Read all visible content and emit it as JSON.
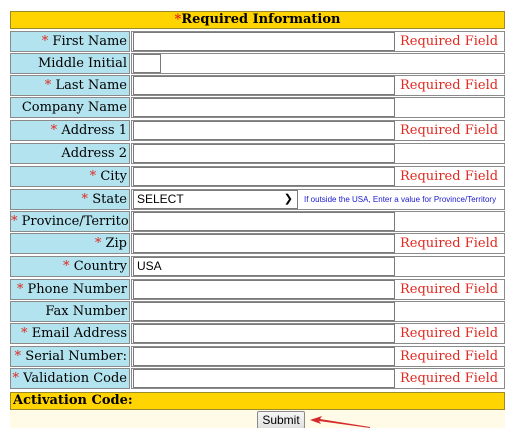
{
  "header": {
    "required_mark": "*",
    "title": "Required Information"
  },
  "fields": [
    {
      "mark": "* ",
      "label": "First Name",
      "value": "",
      "required_text": "Required Field"
    },
    {
      "mark": "",
      "label": "Middle Initial",
      "value": "",
      "required_text": ""
    },
    {
      "mark": "* ",
      "label": "Last Name",
      "value": "",
      "required_text": "Required Field"
    },
    {
      "mark": "",
      "label": "Company Name",
      "value": "",
      "required_text": ""
    },
    {
      "mark": "* ",
      "label": "Address 1",
      "value": "",
      "required_text": "Required Field"
    },
    {
      "mark": "",
      "label": "Address 2",
      "value": "",
      "required_text": ""
    },
    {
      "mark": "* ",
      "label": "City",
      "value": "",
      "required_text": "Required Field"
    },
    {
      "mark": "* ",
      "label": "State",
      "select_value": "SELECT",
      "note": "If outside the USA, Enter a value for Province/Territory"
    },
    {
      "mark": "* ",
      "label": "Province/Territory",
      "value": "",
      "required_text": ""
    },
    {
      "mark": "* ",
      "label": "Zip",
      "value": "",
      "required_text": "Required Field"
    },
    {
      "mark": "* ",
      "label": "Country",
      "value": "USA",
      "required_text": ""
    },
    {
      "mark": "* ",
      "label": "Phone Number",
      "value": "",
      "required_text": "Required Field"
    },
    {
      "mark": "",
      "label": "Fax Number",
      "value": "",
      "required_text": ""
    },
    {
      "mark": "* ",
      "label": "Email Address",
      "value": "",
      "required_text": "Required Field"
    },
    {
      "mark": "* ",
      "label": "Serial Number:",
      "value": "",
      "required_text": "Required Field"
    },
    {
      "mark": "* ",
      "label": "Validation Code",
      "value": "",
      "required_text": "Required Field"
    }
  ],
  "activation": {
    "label": "Activation Code:"
  },
  "submit": {
    "label": "Submit"
  },
  "colors": {
    "header_bg": "#ffd400",
    "label_bg": "#b3e3ee",
    "required_red": "#e0281f",
    "note_blue": "#1a1acc",
    "arrow": "#d42a2a"
  }
}
